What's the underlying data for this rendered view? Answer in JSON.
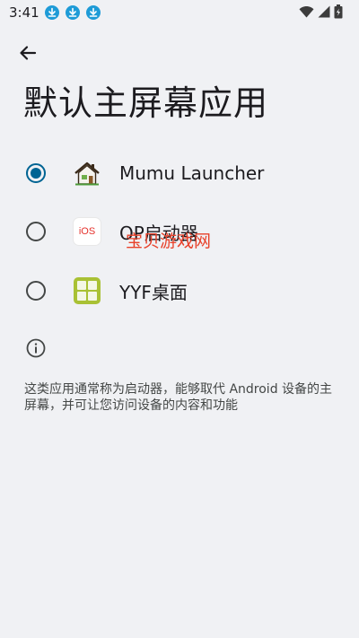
{
  "status_bar": {
    "time": "3:41",
    "notification_icons": [
      "download-icon",
      "download-icon",
      "download-icon"
    ],
    "right_icons": [
      "wifi-icon",
      "signal-icon",
      "battery-icon"
    ]
  },
  "header": {
    "back_icon": "arrow-back-icon",
    "title": "默认主屏幕应用"
  },
  "options": [
    {
      "label": "Mumu Launcher",
      "icon": "house-icon",
      "selected": true
    },
    {
      "label": "OP启动器",
      "icon": "ios-icon",
      "icon_text": "iOS",
      "selected": false
    },
    {
      "label": "YYF桌面",
      "icon": "yyf-grid-icon",
      "selected": false
    }
  ],
  "watermark": "宝贝游戏网",
  "info": {
    "icon": "info-icon",
    "description": "这类应用通常称为启动器，能够取代 Android 设备的主屏幕，并可让您访问设备的内容和功能"
  },
  "colors": {
    "background": "#f0f1f4",
    "accent": "#006493",
    "download_badge": "#1e9bd7",
    "watermark": "#e8412a"
  }
}
